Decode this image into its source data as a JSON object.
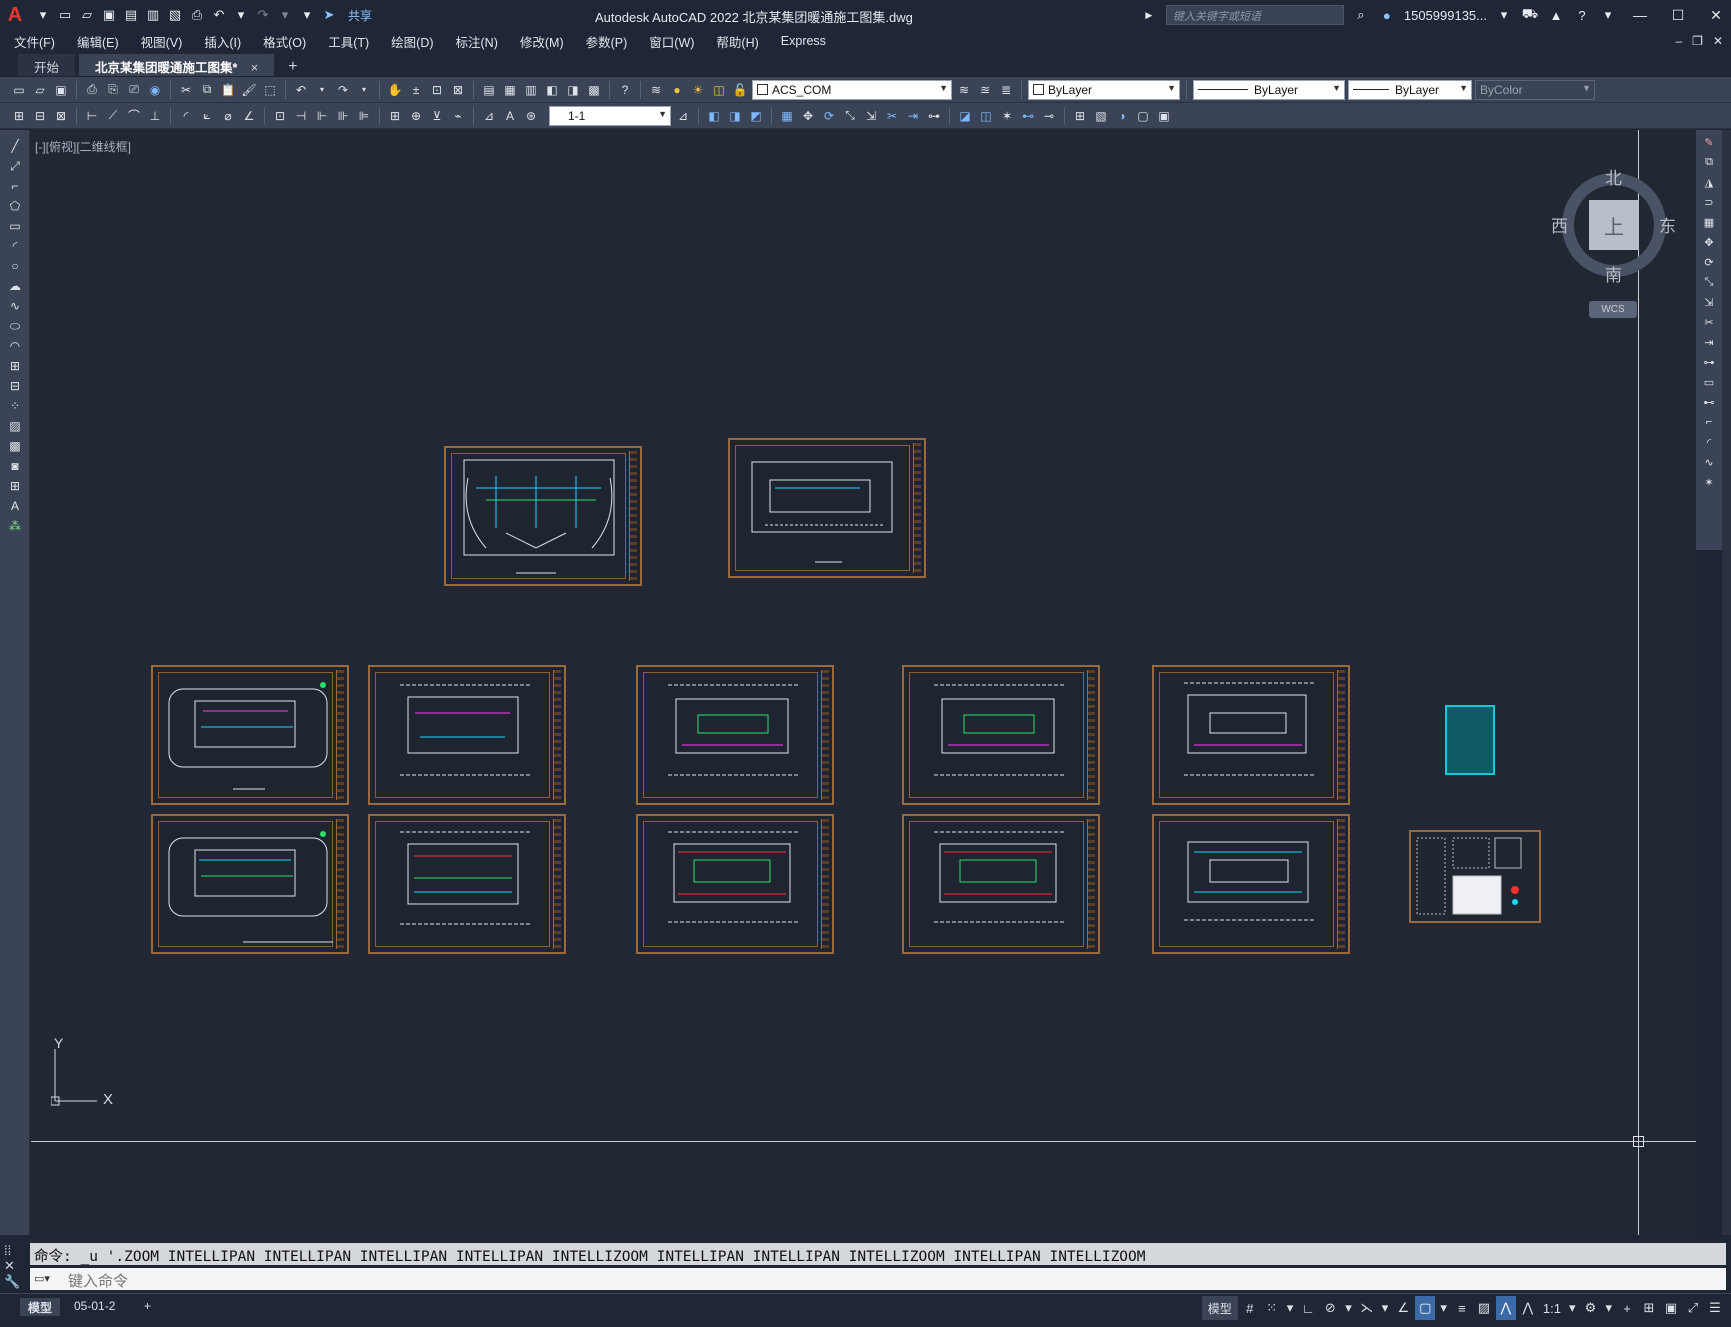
{
  "app": {
    "title": "Autodesk AutoCAD 2022    北京某集团暖通施工图集.dwg",
    "logo": "A",
    "share_label": "共享",
    "search_placeholder": "键入关键字或短语",
    "user": "1505999135...",
    "accent_color": "#e23a2e"
  },
  "menu": [
    "文件(F)",
    "编辑(E)",
    "视图(V)",
    "插入(I)",
    "格式(O)",
    "工具(T)",
    "绘图(D)",
    "标注(N)",
    "修改(M)",
    "参数(P)",
    "窗口(W)",
    "帮助(H)",
    "Express"
  ],
  "tabs": {
    "start": "开始",
    "active_doc": "北京某集团暖通施工图集*",
    "close": "×",
    "add": "+"
  },
  "toolbar": {
    "layer": "ACS_COM",
    "color": "ByLayer",
    "linetype": "ByLayer",
    "lineweight": "ByLayer",
    "plotstyle": "ByColor",
    "scale": "1-1"
  },
  "viewport": {
    "label": "[-][俯视][二维线框]",
    "viewcube": {
      "north": "北",
      "south": "南",
      "east": "东",
      "west": "西",
      "face": "上",
      "wcs": "WCS"
    },
    "ucs": {
      "x": "X",
      "y": "Y"
    }
  },
  "command": {
    "history": "命令: _u '.ZOOM INTELLIPAN INTELLIPAN INTELLIPAN INTELLIPAN INTELLIZOOM INTELLIPAN INTELLIPAN INTELLIZOOM INTELLIPAN INTELLIZOOM",
    "placeholder": "键入命令"
  },
  "status": {
    "layouts": [
      "模型",
      "05-01-2"
    ],
    "add": "+",
    "model": "模型",
    "scale": "1:1"
  }
}
